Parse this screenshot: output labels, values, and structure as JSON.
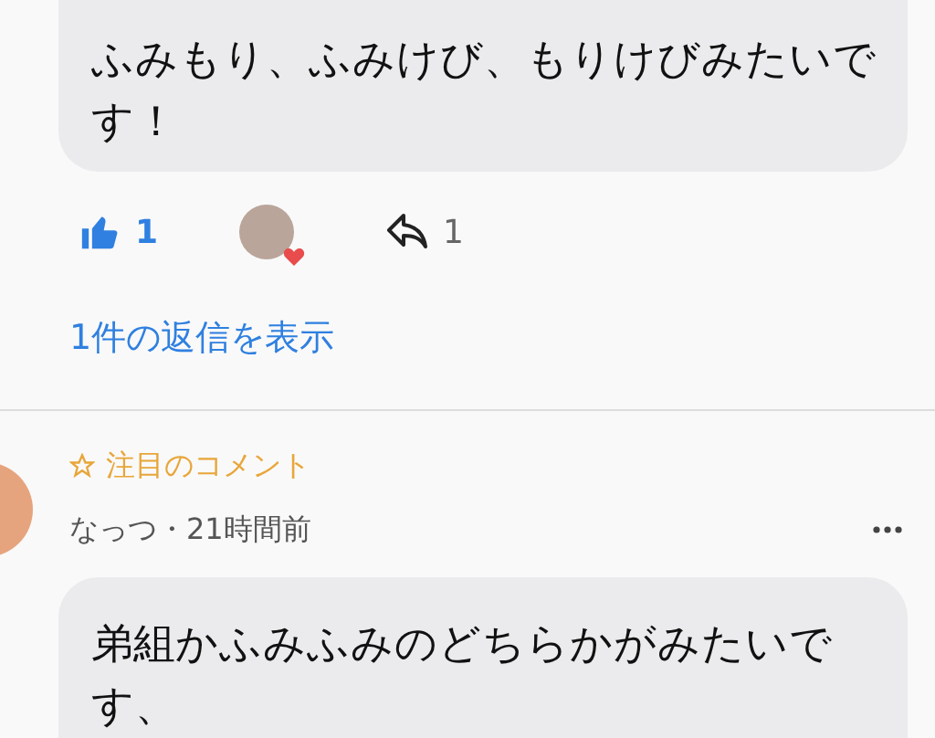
{
  "comments": [
    {
      "text": "ふみもり、ふみけび、もりけびみたいです！",
      "liked": true,
      "likes": "1",
      "reply_count": "1",
      "show_replies": "1件の返信を表示"
    },
    {
      "badge": "注目のコメント",
      "author": "なっつ・21時間前",
      "text": "弟組かふみふみのどちらかがみたいです、"
    }
  ]
}
